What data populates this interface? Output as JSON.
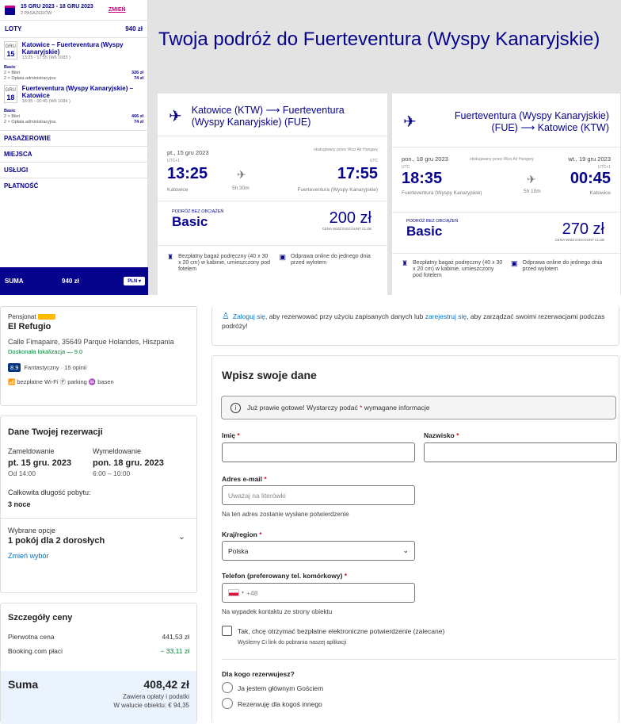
{
  "wizz": {
    "dates": "15 GRU 2023 - 18 GRU 2023",
    "passengers": "2 PASAŻERÓW",
    "change": "ZMIEŃ",
    "loty_label": "LOTY",
    "loty_price": "940 zł",
    "seg1": {
      "month": "GRU",
      "day": "15",
      "route": "Katowice – Fuerteventura (Wyspy Kanaryjskie)",
      "time": "13:25 - 17:55 (W6 1083 )",
      "bundle": "Basic",
      "fee1": "2 × Bilet",
      "fee1_price": "326 zł",
      "fee2": "2 × Opłata administracyjna",
      "fee2_price": "74 zł"
    },
    "seg2": {
      "month": "GRU",
      "day": "18",
      "route": "Fuerteventura (Wyspy Kanaryjskie) – Katowice",
      "time": "18:35 - 00:45 (W6 1084 )",
      "bundle": "Basic",
      "fee1": "2 × Bilet",
      "fee1_price": "466 zł",
      "fee2": "2 × Opłata administracyjna",
      "fee2_price": "74 zł"
    },
    "accordion": [
      "PASAŻEROWIE",
      "MIEJSCA",
      "USŁUGI",
      "PŁATNOŚĆ"
    ],
    "suma_label": "SUMA",
    "suma_value": "940 zł",
    "currency": "PLN ▾",
    "trip_title": "Twoja podróż do Fuerteventura (Wyspy Kanaryjskie)",
    "f1": {
      "route": "Katowice (KTW) ⟶ Fuerteventura (Wyspy Kanaryjskie) (FUE)",
      "dep_date": "pt., 15 gru 2023",
      "operator": "obsługiwany przez Wizz Air Hungary",
      "dep_utc": "UTC+1",
      "arr_utc": "UTC",
      "dep": "13:25",
      "arr": "17:55",
      "dep_city": "Katowice",
      "arr_city": "Fuerteventura (Wyspy Kanaryjskie)",
      "duration": "5h 30m",
      "bundle_label": "PODRÓŻ BEZ OBCIĄŻEŃ",
      "bundle": "Basic",
      "price": "200 zł",
      "club": "CENA WIZZ DISCOUNT CLUB"
    },
    "f2": {
      "route": "Fuerteventura (Wyspy Kanaryjskie) (FUE) ⟶ Katowice (KTW)",
      "dep_date": "pon., 18 gru 2023",
      "arr_date": "wt., 19 gru 2023",
      "operator": "obsługiwany przez Wizz Air Hungary",
      "dep_utc": "UTC",
      "arr_utc": "UTC+1",
      "dep": "18:35",
      "arr": "00:45",
      "dep_city": "Fuerteventura (Wyspy Kanaryjskie)",
      "arr_city": "Katowice",
      "duration": "5h 10m",
      "bundle_label": "PODRÓŻ BEZ OBCIĄŻEŃ",
      "bundle": "Basic",
      "price": "270 zł",
      "club": "CENA WIZZ DISCOUNT CLUB"
    },
    "bag": "Bezpłatny bagaż podręczny (40 x 30 x 20 cm) w kabinie, umieszczony pod fotelem",
    "checkin": "Odprawa online do jednego dnia przed wylotem"
  },
  "hotel": {
    "type": "Pensjonat",
    "name": "El Refugio",
    "address": "Calle Fimapaire, 35649 Parque Holandes, Hiszpania",
    "location": "Doskonała lokalizacja — 9.0",
    "score": "8.9",
    "score_text": "Fantastyczny · 15 opinii",
    "facilities": "📶 bezpłatne Wi-Fi  Ⓟ parking  ♒ basen"
  },
  "booking": {
    "title": "Dane Twojej rezerwacji",
    "checkin_label": "Zameldowanie",
    "checkout_label": "Wymeldowanie",
    "checkin_date": "pt. 15 gru. 2023",
    "checkout_date": "pon. 18 gru. 2023",
    "checkin_time": "Od 14:00",
    "checkout_time": "6:00 – 10:00",
    "stay_label": "Całkowita długość pobytu:",
    "stay": "3 noce",
    "options_label": "Wybrane opcje",
    "options": "1 pokój dla 2 dorosłych",
    "change": "Zmień wybór"
  },
  "price": {
    "title": "Szczegóły ceny",
    "orig_label": "Pierwotna cena",
    "orig": "441,53 zł",
    "disc_label": "Booking.com płaci",
    "disc": "− 33,11 zł",
    "total_label": "Suma",
    "total": "408,42 zł",
    "taxes": "Zawiera opłaty i podatki",
    "local": "W walucie obiektu: € 94,35"
  },
  "signin": {
    "link1": "Zaloguj się",
    "text1": ", aby rezerwować przy użyciu zapisanych danych lub ",
    "link2": "zarejestruj się",
    "text2": ", aby zarządzać swoimi rezerwacjami podczas podróży!"
  },
  "form": {
    "title": "Wpisz swoje dane",
    "notice": "Już prawie gotowe! Wystarczy podać",
    "notice2": "wymagane informacje",
    "first": "Imię",
    "last": "Nazwisko",
    "email": "Adres e-mail",
    "email_ph": "Uważaj na literówki",
    "email_hint": "Na ten adres zostanie wysłane potwierdzenie",
    "country": "Kraj/region",
    "country_val": "Polska",
    "phone": "Telefon (preferowany tel. komórkowy)",
    "phone_val": "+48",
    "phone_hint": "Na wypadek kontaktu ze strony obiektu",
    "sms": "Tak, chcę otrzymać bezpłatne elektroniczne potwierdzenie (zalecane)",
    "sms_hint": "Wyślemy Ci link do pobrania naszej aplikacji",
    "who": "Dla kogo rezerwujesz?",
    "opt1": "Ja jestem głównym Gościem",
    "opt2": "Rezerwuję dla kogoś innego"
  },
  "colors": {
    "wizz_blue": "#06038d",
    "wizz_pink": "#c6007e",
    "booking_blue": "#003580",
    "link": "#0071c2"
  }
}
